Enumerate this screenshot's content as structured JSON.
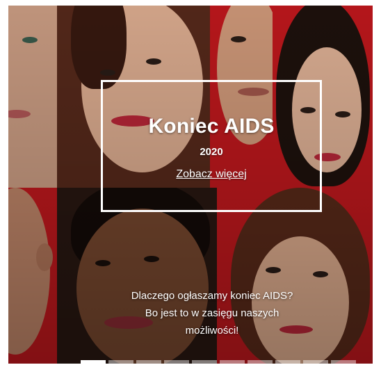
{
  "hero": {
    "title": "Koniec AIDS",
    "year": "2020",
    "link_label": "Zobacz więcej",
    "caption_lines": [
      "Dlaczego ogłaszamy koniec AIDS?",
      "Bo jest to w zasięgu naszych",
      "możliwości!"
    ]
  },
  "carousel": {
    "slide_count": 10,
    "active_index": 0
  },
  "colors": {
    "brand_red": "#c8191e",
    "dark_red": "#7a1212",
    "text": "#ffffff"
  }
}
